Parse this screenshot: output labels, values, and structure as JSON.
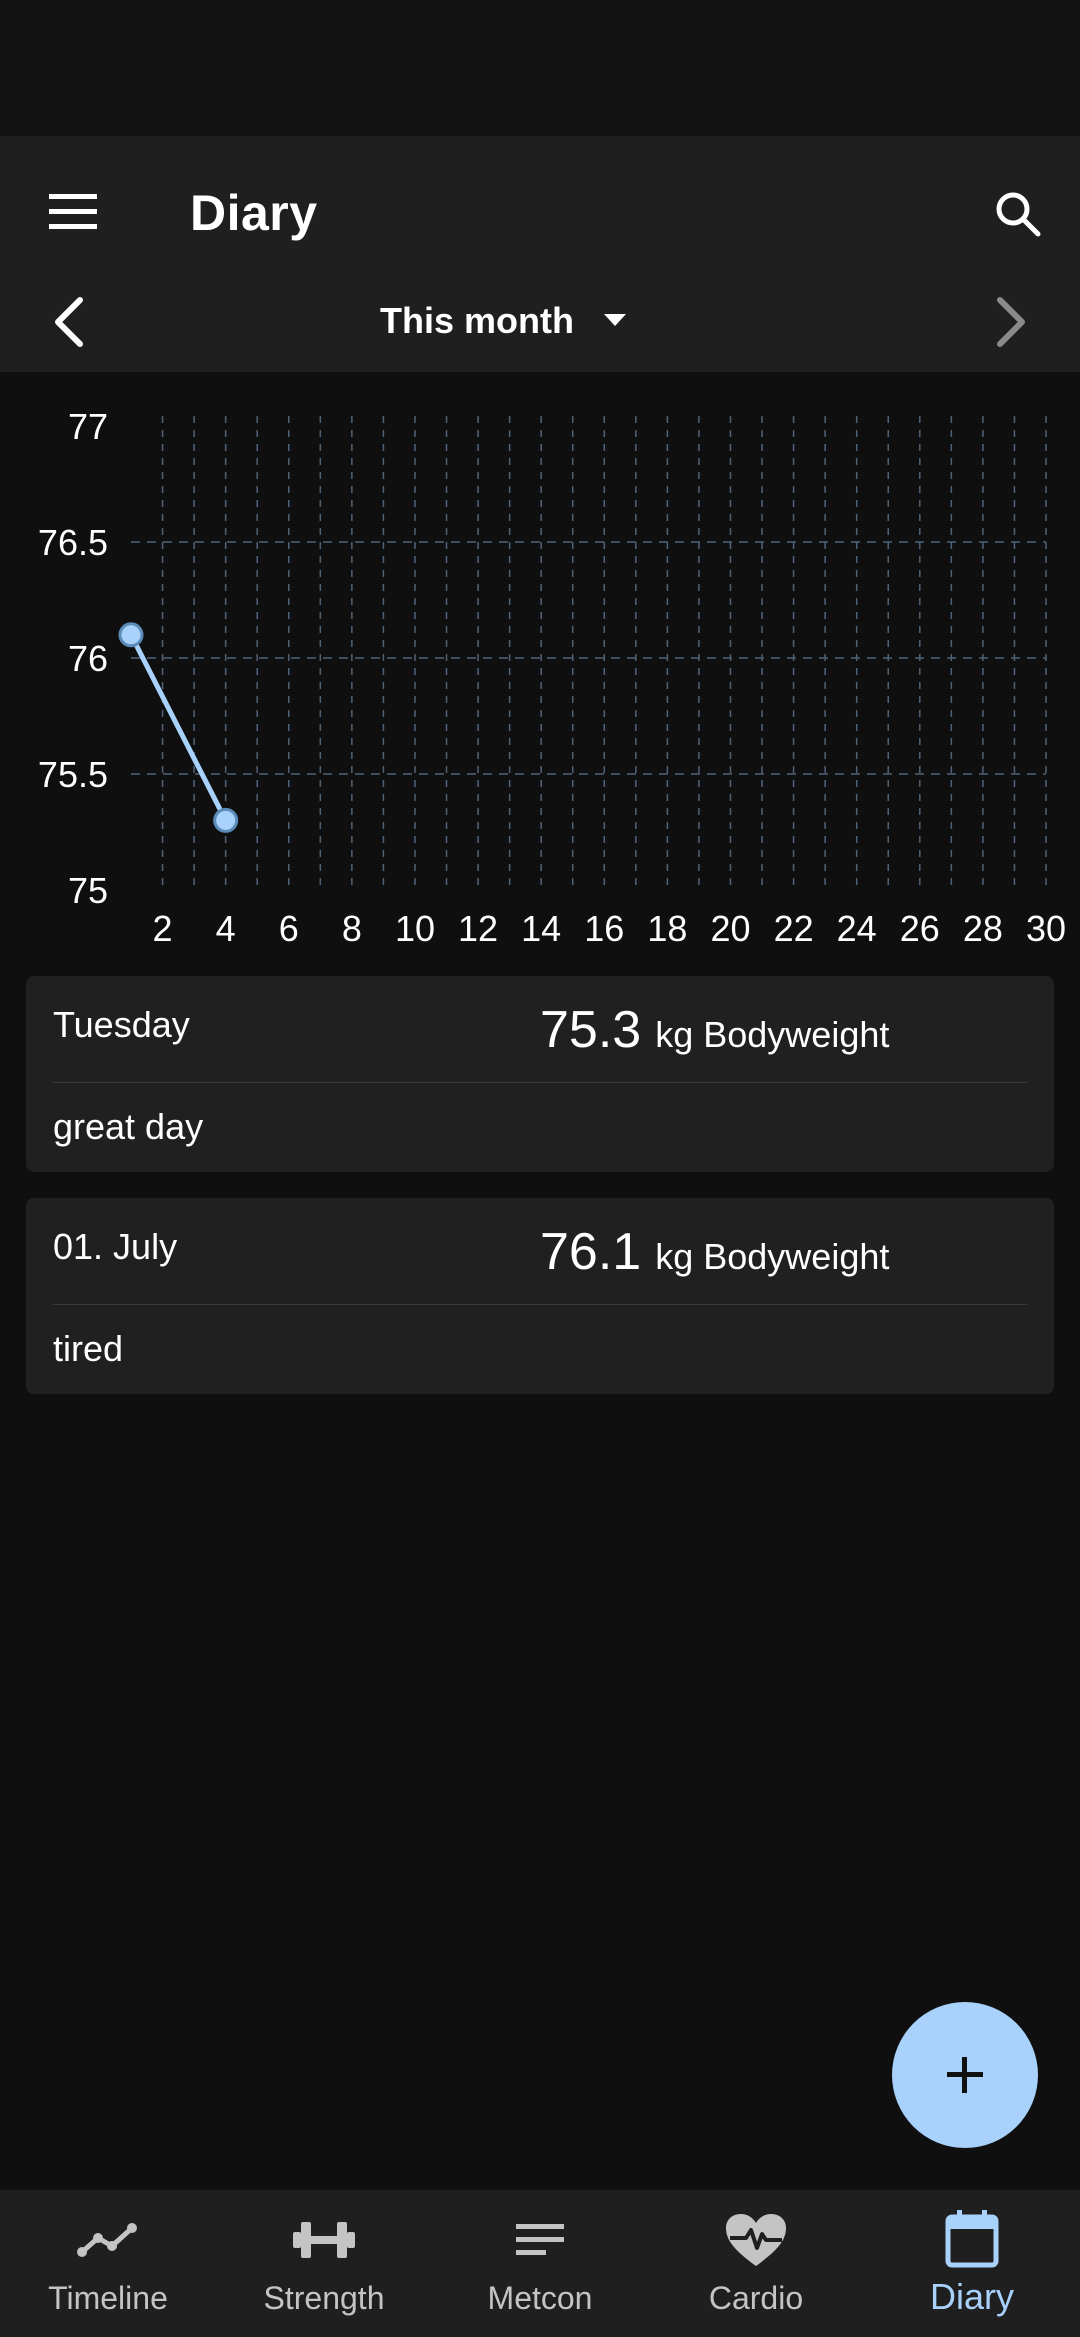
{
  "app_bar": {
    "title": "Diary",
    "period_label": "This month"
  },
  "chart_data": {
    "type": "line",
    "x_ticks": [
      "2",
      "4",
      "6",
      "8",
      "10",
      "12",
      "14",
      "16",
      "18",
      "20",
      "22",
      "24",
      "26",
      "28",
      "30"
    ],
    "y_ticks": [
      "77",
      "76.5",
      "76",
      "75.5",
      "75"
    ],
    "xlim": [
      1,
      30
    ],
    "ylim": [
      75,
      77
    ],
    "grid": true,
    "series": [
      {
        "x": [
          1,
          4
        ],
        "y": [
          76.1,
          75.3
        ]
      }
    ],
    "line_color": "#a8d1fb"
  },
  "entries": [
    {
      "date": "Tuesday",
      "value": "75.3",
      "unit": "kg Bodyweight",
      "note": "great day"
    },
    {
      "date": "01. July",
      "value": "76.1",
      "unit": "kg Bodyweight",
      "note": "tired"
    }
  ],
  "bottom_nav": [
    {
      "label": "Timeline",
      "icon": "timeline-icon"
    },
    {
      "label": "Strength",
      "icon": "dumbbell-icon"
    },
    {
      "label": "Metcon",
      "icon": "metcon-icon"
    },
    {
      "label": "Cardio",
      "icon": "heart-pulse-icon"
    },
    {
      "label": "Diary",
      "icon": "calendar-icon",
      "active": true
    }
  ],
  "colors": {
    "accent": "#a8d1fb",
    "background": "#0f0f0f",
    "surface": "#1f1f1f"
  }
}
